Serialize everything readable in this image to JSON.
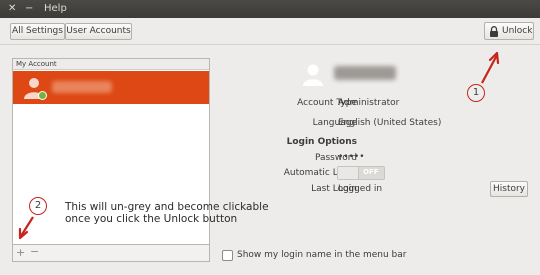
{
  "window": {
    "title": "Help",
    "close_glyph": "✕",
    "minimize_glyph": "−"
  },
  "toolbar": {
    "all_settings_label": "All Settings",
    "user_accounts_label": "User Accounts",
    "unlock_label": "Unlock"
  },
  "accounts_list": {
    "header": "My Account",
    "selected_user_status_color": "#73b23b",
    "selection_color": "#dd4814"
  },
  "list_controls": {
    "add_glyph": "+",
    "remove_glyph": "−"
  },
  "details": {
    "account_type_label": "Account Type",
    "account_type_value": "Administrator",
    "language_label": "Language",
    "language_value": "English (United States)",
    "login_options_heading": "Login Options",
    "password_label": "Password",
    "password_value": "•••••",
    "automatic_login_label": "Automatic Login",
    "automatic_login_value": "OFF",
    "last_login_label": "Last Login",
    "last_login_value": "Logged in",
    "history_label": "History",
    "show_login_name_label": "Show my login name in the menu bar"
  },
  "annotations": {
    "callout_1": "1",
    "callout_2": "2",
    "note_line1": "This will un-grey and become clickable",
    "note_line2": "once you click the Unlock button",
    "arrow_color": "#c7251c"
  }
}
